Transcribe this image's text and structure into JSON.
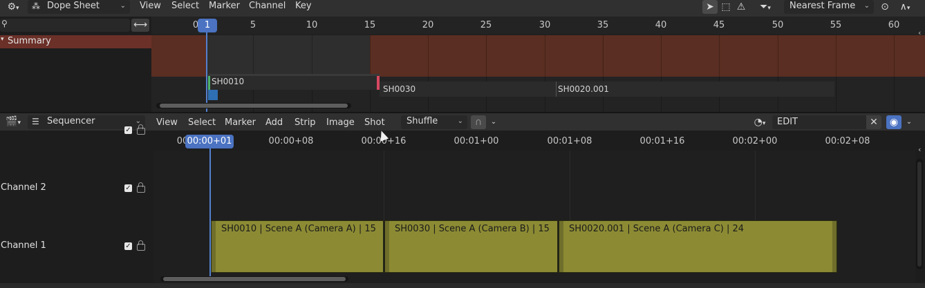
{
  "dopesheet": {
    "editor_type": "Dope Sheet",
    "menus": [
      "View",
      "Select",
      "Marker",
      "Channel",
      "Key"
    ],
    "snap_mode": "Nearest Frame",
    "search_placeholder": "",
    "summary_label": "Summary",
    "ruler_ticks": [
      "0",
      "5",
      "10",
      "15",
      "20",
      "25",
      "30",
      "35",
      "40",
      "45",
      "50",
      "55",
      "60"
    ],
    "current_frame": "1",
    "strips": [
      "SH0010",
      "SH0030",
      "SH0020.001"
    ]
  },
  "sequencer": {
    "editor_type": "Sequencer",
    "menus": [
      "View",
      "Select",
      "Marker",
      "Add",
      "Strip",
      "Image",
      "Shot"
    ],
    "shuffle_mode": "Shuffle",
    "scene_field": "EDIT",
    "ruler_ticks": [
      "00",
      "00:00+08",
      "00:00+16",
      "00:01+00",
      "00:01+08",
      "00:01+16",
      "00:02+00",
      "00:02+08"
    ],
    "current_time": "00:00+01",
    "channels": [
      "Channel 2",
      "Channel 1"
    ],
    "strips": [
      "SH0010 | Scene A (Camera A) | 15",
      "SH0030 | Scene A (Camera B) | 15",
      "SH0020.001 | Scene A (Camera C) | 24"
    ]
  },
  "colors": {
    "playhead": "#5480cf",
    "strip": "#8c8b34",
    "summary": "#6b3028"
  }
}
